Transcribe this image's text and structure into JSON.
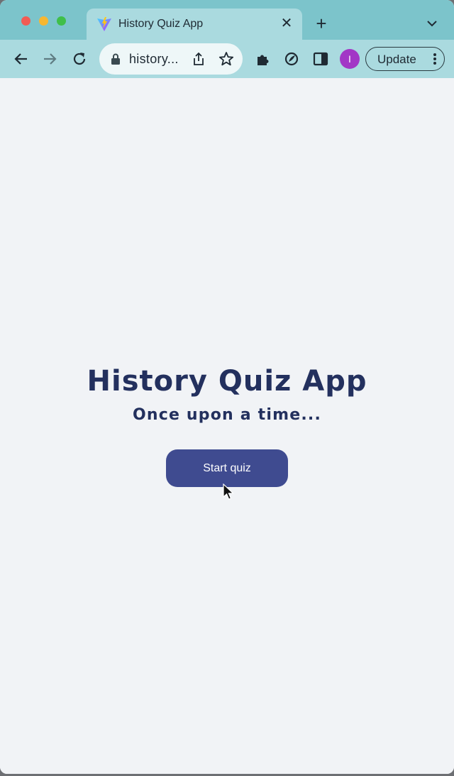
{
  "browser": {
    "tab": {
      "title": "History Quiz App",
      "favicon": "vite-logo-icon"
    },
    "address_bar": {
      "url_display": "history..."
    },
    "profile_initial": "I",
    "update_label": "Update"
  },
  "page": {
    "title": "History Quiz App",
    "subtitle": "Once upon a time...",
    "start_button_label": "Start quiz"
  },
  "colors": {
    "tab_strip": "#7cc4cb",
    "toolbar": "#aadadf",
    "page_background": "#f1f3f6",
    "heading_text": "#23305e",
    "primary_button": "#3f4b90",
    "profile_avatar": "#a237c6"
  }
}
